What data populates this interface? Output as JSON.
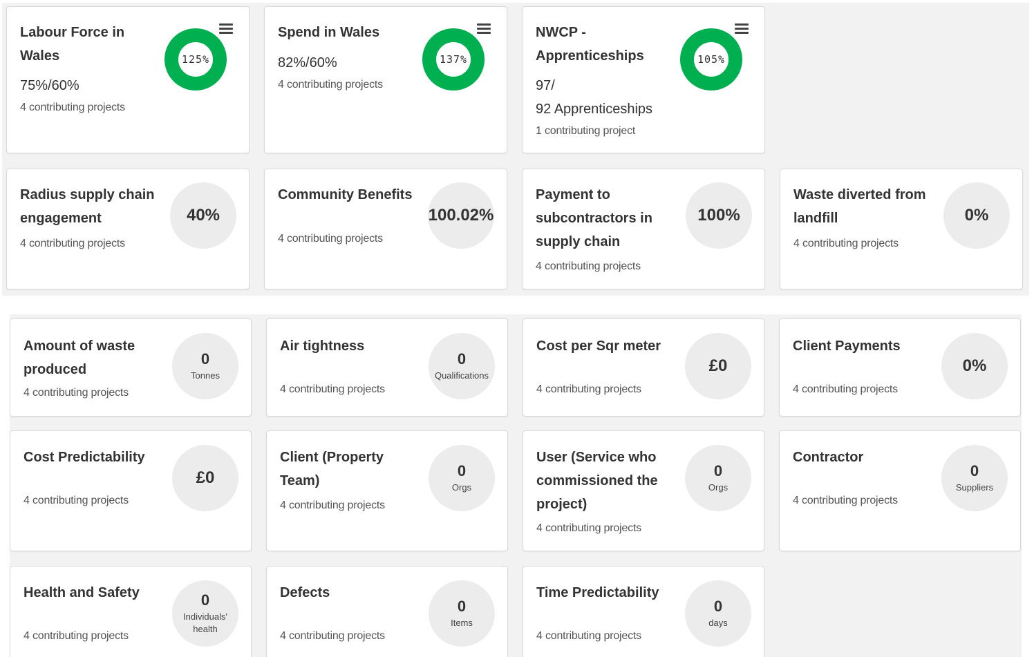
{
  "top_cards": [
    {
      "title_lines": [
        "Labour Force in",
        "Wales"
      ],
      "value_lines": [
        "75%/60%"
      ],
      "contributing": "4 contributing projects",
      "donut_label": "125%",
      "donut_color": "#00b050"
    },
    {
      "title_lines": [
        "Spend in Wales"
      ],
      "value_lines": [
        "82%/60%"
      ],
      "contributing": "4 contributing projects",
      "donut_label": "137%",
      "donut_color": "#00b050"
    },
    {
      "title_lines": [
        "NWCP -",
        "Apprenticeships"
      ],
      "value_lines": [
        "97/",
        "92 Apprenticeships"
      ],
      "contributing": "1 contributing project",
      "donut_label": "105%",
      "donut_color": "#00b050"
    }
  ],
  "mid_cards": [
    {
      "title_lines": [
        "Radius supply chain",
        "engagement"
      ],
      "contributing": "4 contributing projects",
      "circle_value": "40%"
    },
    {
      "title_lines": [
        "Community Benefits"
      ],
      "contributing": "4 contributing projects",
      "circle_value": "100.02%"
    },
    {
      "title_lines": [
        "Payment to",
        "subcontractors in",
        "supply chain"
      ],
      "contributing": "4 contributing projects",
      "circle_value": "100%"
    },
    {
      "title_lines": [
        "Waste diverted from",
        "landfill"
      ],
      "contributing": "4 contributing projects",
      "circle_value": "0%"
    }
  ],
  "bottom_cards": [
    {
      "title_lines": [
        "Amount of waste",
        "produced"
      ],
      "contributing": "4 contributing projects",
      "circle_value": "0",
      "circle_unit": "Tonnes"
    },
    {
      "title_lines": [
        "Air tightness"
      ],
      "contributing": "4 contributing projects",
      "circle_value": "0",
      "circle_unit": "Qualifications"
    },
    {
      "title_lines": [
        "Cost per Sqr meter"
      ],
      "contributing": "4 contributing projects",
      "circle_value": "£0",
      "circle_unit": ""
    },
    {
      "title_lines": [
        "Client Payments"
      ],
      "contributing": "4 contributing projects",
      "circle_value": "0%",
      "circle_unit": ""
    },
    {
      "title_lines": [
        "Cost Predictability"
      ],
      "contributing": "4 contributing projects",
      "circle_value": "£0",
      "circle_unit": ""
    },
    {
      "title_lines": [
        "Client (Property",
        "Team)"
      ],
      "contributing": "4 contributing projects",
      "circle_value": "0",
      "circle_unit": "Orgs"
    },
    {
      "title_lines": [
        "User (Service who",
        "commissioned the",
        "project)"
      ],
      "contributing": "4 contributing projects",
      "circle_value": "0",
      "circle_unit": "Orgs"
    },
    {
      "title_lines": [
        "Contractor"
      ],
      "contributing": "4 contributing projects",
      "circle_value": "0",
      "circle_unit": "Suppliers"
    },
    {
      "title_lines": [
        "Health and Safety"
      ],
      "contributing": "4 contributing projects",
      "circle_value": "0",
      "circle_unit": "Individuals'\nhealth"
    },
    {
      "title_lines": [
        "Defects"
      ],
      "contributing": "4 contributing projects",
      "circle_value": "0",
      "circle_unit": "Items"
    },
    {
      "title_lines": [
        "Time Predictability"
      ],
      "contributing": "4 contributing projects",
      "circle_value": "0",
      "circle_unit": "days"
    }
  ]
}
